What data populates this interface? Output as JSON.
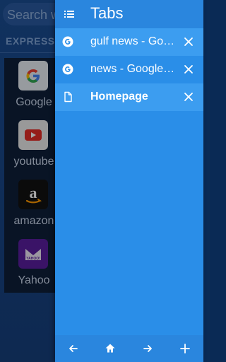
{
  "background": {
    "search_placeholder": "Search w",
    "section_label": "EXPRESS N",
    "shortcuts": [
      {
        "label": "Google",
        "icon": "google-logo"
      },
      {
        "label": "youtube",
        "icon": "youtube-logo"
      },
      {
        "label": "amazon",
        "icon": "amazon-logo"
      },
      {
        "label": "Yahoo",
        "icon": "yahoo-logo"
      }
    ],
    "yahoo_logo_text": "YAHOO!"
  },
  "drawer": {
    "title": "Tabs",
    "header_icon": "list-icon",
    "tabs": [
      {
        "label": "gulf news - Google Search",
        "favicon": "google-g-icon"
      },
      {
        "label": "news - Google Search",
        "favicon": "google-g-icon"
      },
      {
        "label": "Homepage",
        "favicon": "document-icon",
        "active": true
      }
    ],
    "bottom_bar": [
      "back-arrow-icon",
      "home-icon",
      "forward-arrow-icon",
      "plus-icon"
    ]
  },
  "colors": {
    "drawer_bg": "#2a8ee8",
    "drawer_header": "#2a86de",
    "selected_tab": "#3c9df0"
  }
}
